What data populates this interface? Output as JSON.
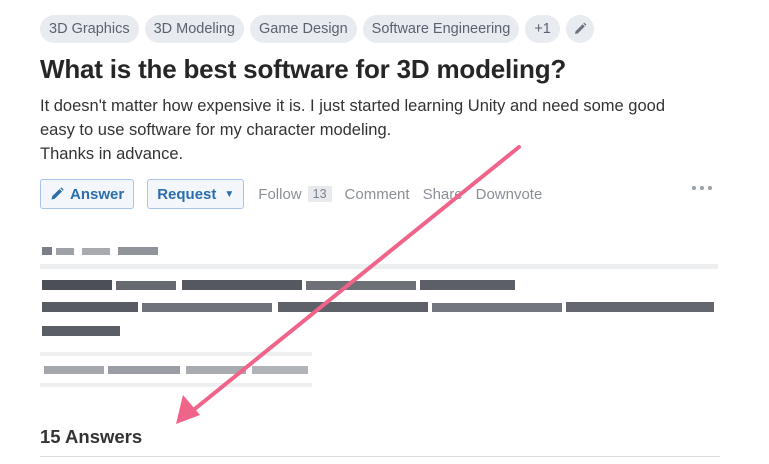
{
  "tags": [
    "3D Graphics",
    "3D Modeling",
    "Game Design",
    "Software Engineering",
    "+1"
  ],
  "question": {
    "title": "What is the best software for 3D modeling?",
    "details": [
      "It doesn't matter how expensive it is. I just started learning Unity and need some good",
      "easy to use software for my character modeling.",
      "Thanks in advance."
    ]
  },
  "actions": {
    "answer_label": "Answer",
    "request_label": "Request",
    "follow_label": "Follow",
    "follow_count": "13",
    "comment_label": "Comment",
    "share_label": "Share",
    "downvote_label": "Downvote"
  },
  "answers_heading": "15 Answers",
  "colors": {
    "accent": "#2b6dad",
    "arrow": "#f0648a",
    "tag_bg": "#e8ebef"
  },
  "icons": {
    "edit": "pencil-icon",
    "answer": "pencil-icon",
    "more": "more-dots-icon",
    "annotation": "arrow-icon"
  }
}
